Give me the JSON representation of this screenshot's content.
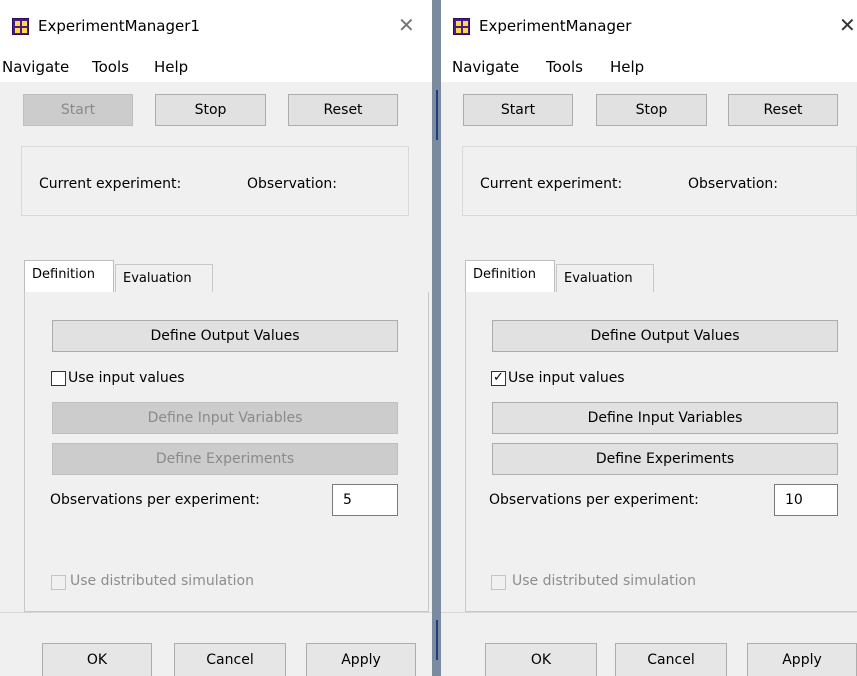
{
  "windows": [
    {
      "title": "ExperimentManager1",
      "close_glyph": "✕",
      "menu": [
        "Navigate",
        "Tools",
        "Help"
      ],
      "controls": {
        "start": "Start",
        "stop": "Stop",
        "reset": "Reset",
        "start_enabled": false
      },
      "status": {
        "current_experiment_label": "Current experiment:",
        "observation_label": "Observation:"
      },
      "tabs": [
        {
          "label": "Definition",
          "active": true
        },
        {
          "label": "Evaluation",
          "active": false
        }
      ],
      "definition": {
        "define_output_values": "Define Output Values",
        "use_input_values_label": "Use input values",
        "use_input_values_checked": false,
        "define_input_variables": "Define Input Variables",
        "define_experiments": "Define Experiments",
        "inputs_enabled": false,
        "observations_label": "Observations per experiment:",
        "observations_value": "5",
        "distributed_label": "Use distributed simulation",
        "distributed_enabled": false
      },
      "dialog_buttons": {
        "ok": "OK",
        "cancel": "Cancel",
        "apply": "Apply"
      }
    },
    {
      "title": "ExperimentManager",
      "close_glyph": "✕",
      "menu": [
        "Navigate",
        "Tools",
        "Help"
      ],
      "controls": {
        "start": "Start",
        "stop": "Stop",
        "reset": "Reset",
        "start_enabled": true
      },
      "status": {
        "current_experiment_label": "Current experiment:",
        "observation_label": "Observation:"
      },
      "tabs": [
        {
          "label": "Definition",
          "active": true
        },
        {
          "label": "Evaluation",
          "active": false
        }
      ],
      "definition": {
        "define_output_values": "Define Output Values",
        "use_input_values_label": "Use input values",
        "use_input_values_checked": true,
        "define_input_variables": "Define Input Variables",
        "define_experiments": "Define Experiments",
        "inputs_enabled": true,
        "observations_label": "Observations per experiment:",
        "observations_value": "10",
        "distributed_label": "Use distributed simulation",
        "distributed_enabled": false
      },
      "dialog_buttons": {
        "ok": "OK",
        "cancel": "Cancel",
        "apply": "Apply"
      }
    }
  ],
  "icons": {
    "app": "experiment-manager-app-icon",
    "close": "close-icon",
    "check": "checkmark-icon"
  },
  "colors": {
    "disabled_button": "#cccccc",
    "button": "#e1e1e1",
    "separator": "#7c8aa0",
    "accent_strip": "#1c3e80"
  }
}
